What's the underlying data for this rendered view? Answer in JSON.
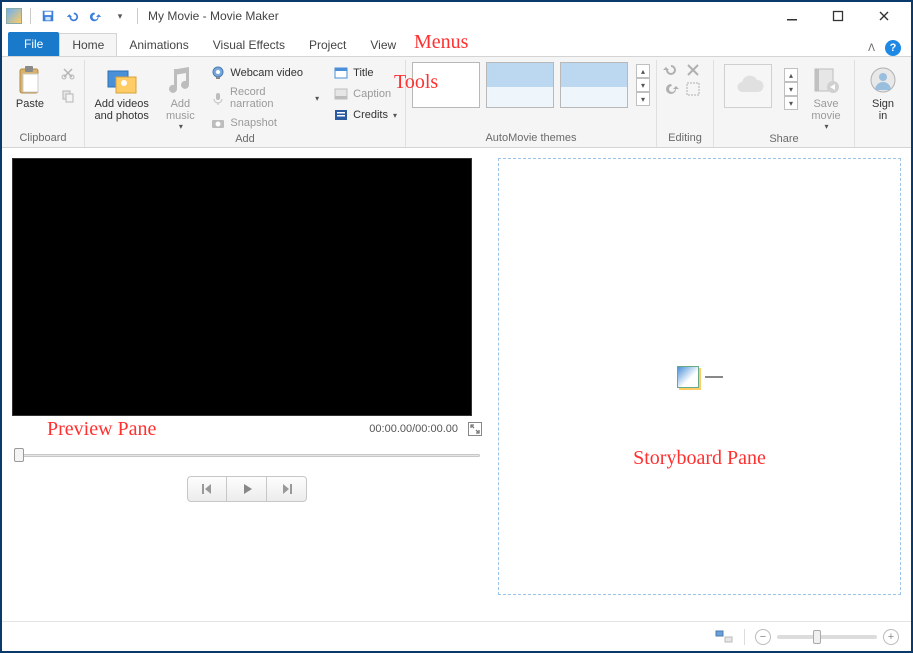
{
  "window": {
    "title": "My Movie - Movie Maker"
  },
  "qat": {
    "save": "Save",
    "undo": "Undo",
    "redo": "Redo"
  },
  "menus": {
    "file": "File",
    "home": "Home",
    "animations": "Animations",
    "visual_effects": "Visual Effects",
    "project": "Project",
    "view": "View"
  },
  "ribbon": {
    "clipboard": {
      "label": "Clipboard",
      "paste": "Paste",
      "cut": "Cut",
      "copy": "Copy"
    },
    "add": {
      "label": "Add",
      "add_videos": "Add videos\nand photos",
      "add_music": "Add\nmusic",
      "webcam": "Webcam video",
      "record": "Record narration",
      "snapshot": "Snapshot",
      "title": "Title",
      "caption": "Caption",
      "credits": "Credits"
    },
    "automovie": {
      "label": "AutoMovie themes"
    },
    "editing": {
      "label": "Editing",
      "rotate_left": "Rotate left",
      "rotate_right": "Rotate right",
      "remove": "Remove",
      "select_all": "Select all"
    },
    "share": {
      "label": "Share",
      "skydrive": "SkyDrive",
      "save_movie": "Save\nmovie"
    },
    "signin": {
      "label": "Sign\nin"
    }
  },
  "preview": {
    "timecode": "00:00.00/00:00.00"
  },
  "annotations": {
    "menus": "Menus",
    "tools": "Tools",
    "preview": "Preview Pane",
    "storyboard": "Storyboard Pane"
  },
  "status": {
    "minus": "−",
    "plus": "+"
  }
}
